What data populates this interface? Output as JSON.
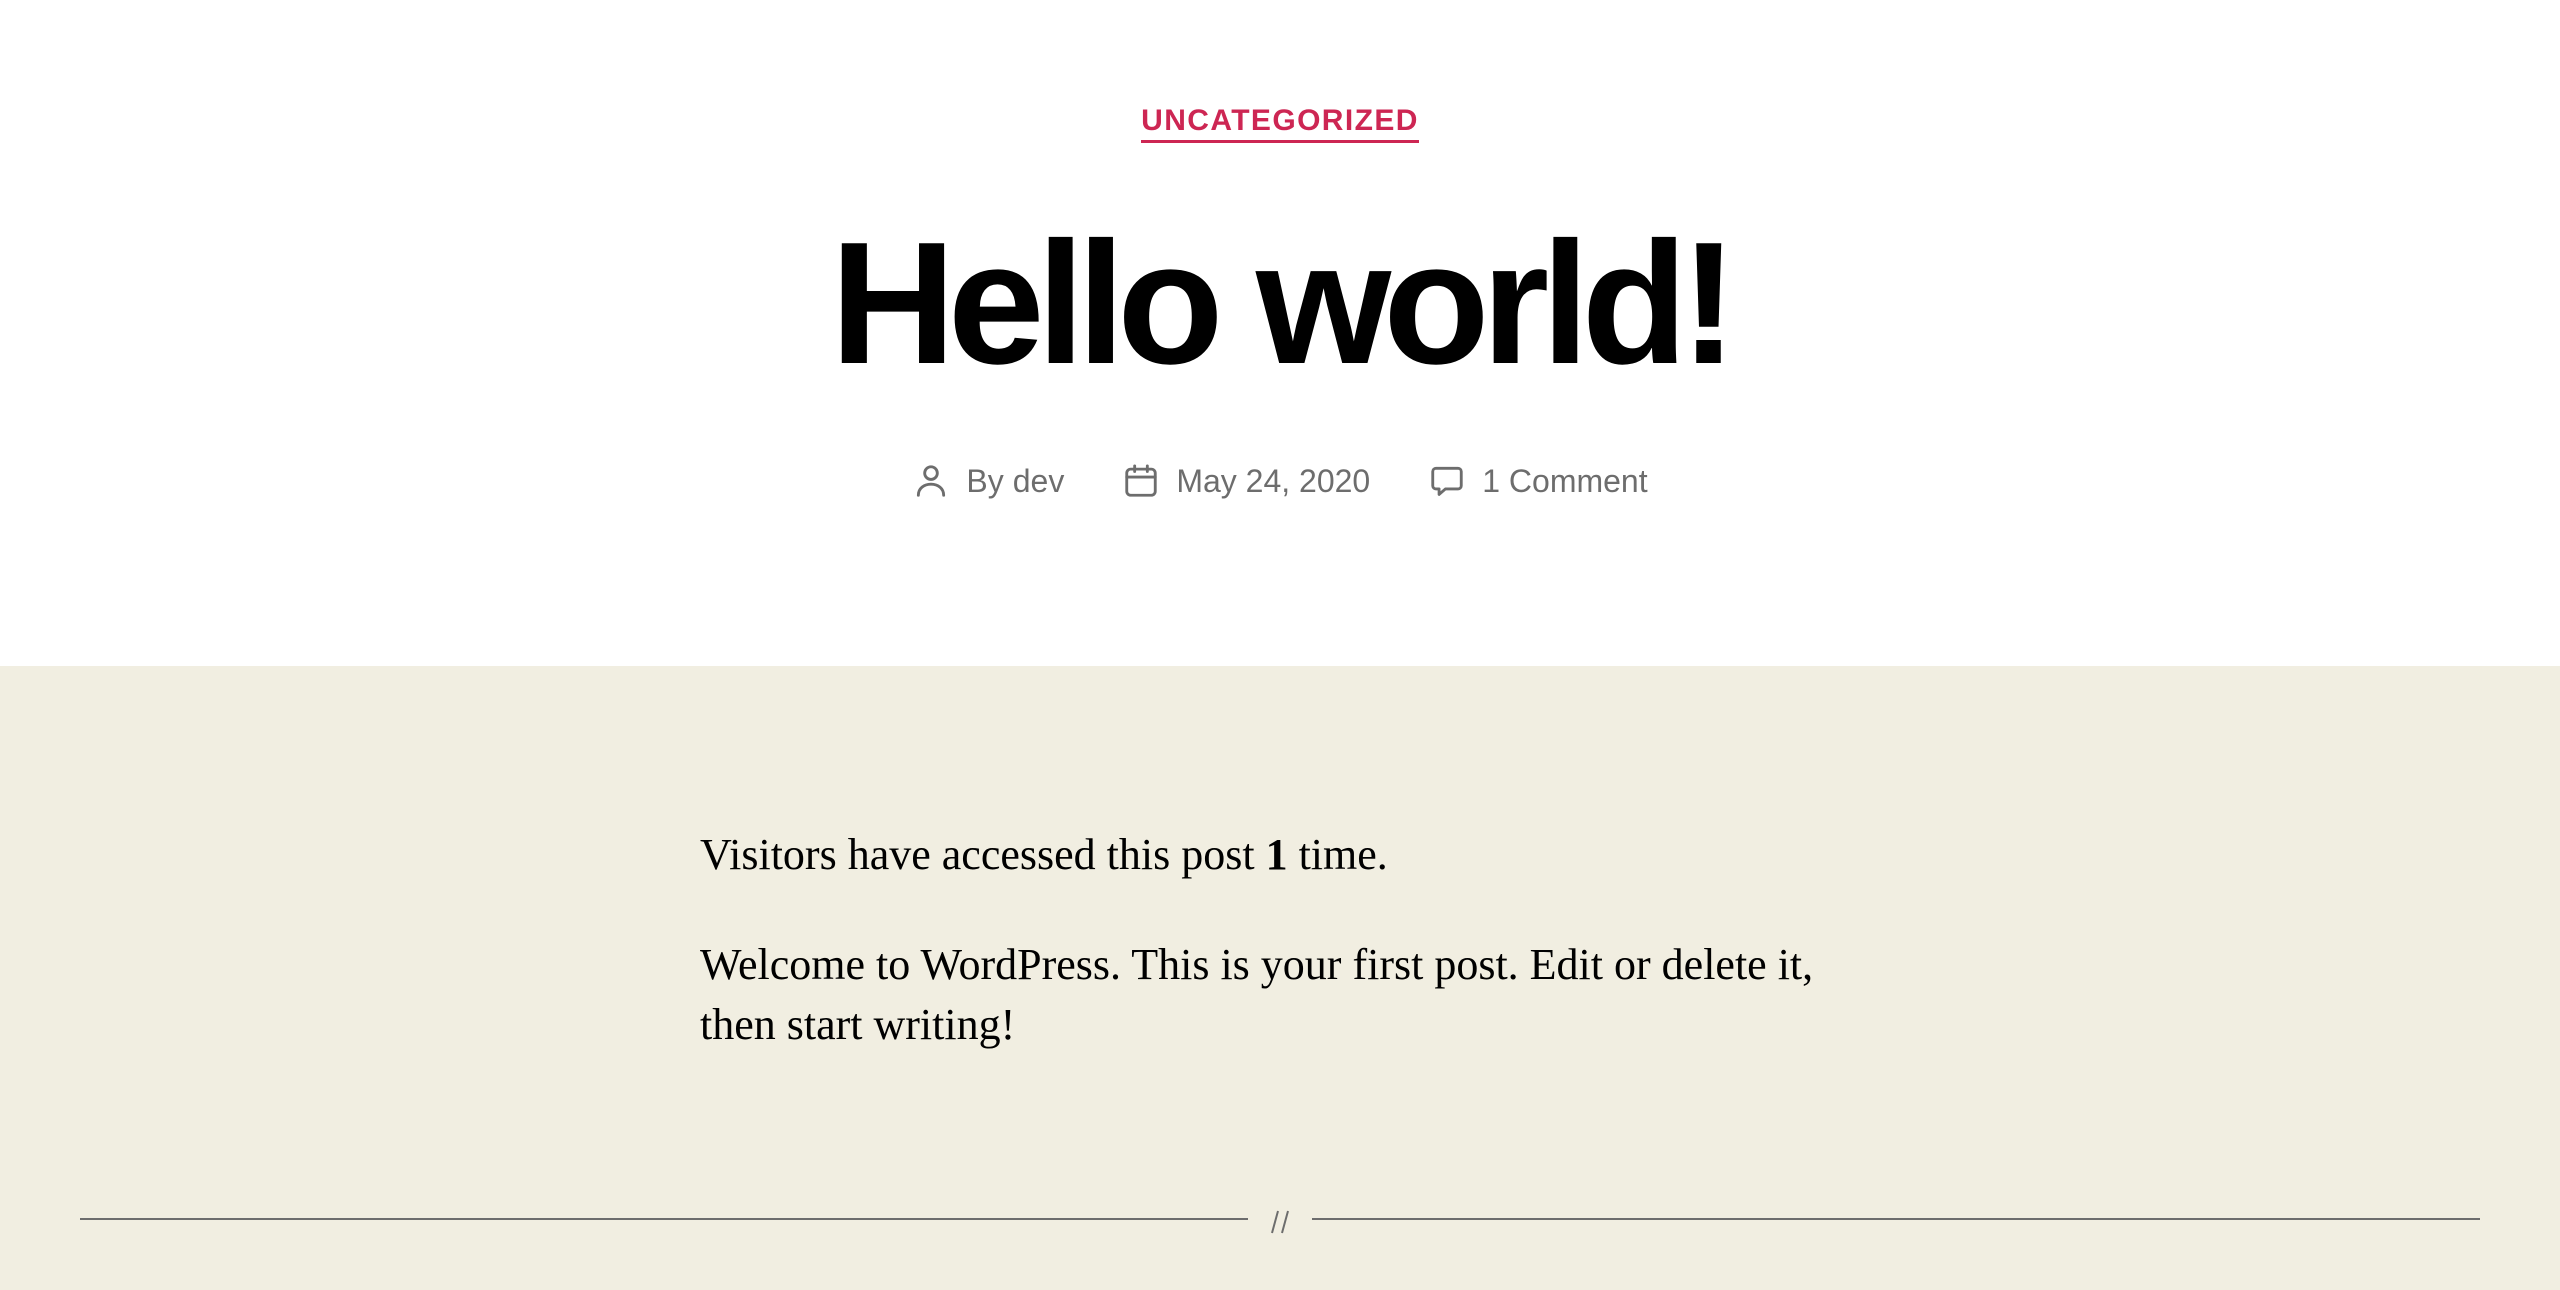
{
  "post": {
    "category": "UNCATEGORIZED",
    "title": "Hello world!",
    "meta": {
      "author_prefix": "By",
      "author": "dev",
      "date": "May 24, 2020",
      "comments": "1 Comment"
    },
    "content": {
      "visitor_text_before": "Visitors have accessed this post",
      "visitor_count": "1",
      "visitor_text_after": "time.",
      "paragraph": "Welcome to WordPress. This is your first post. Edit or delete it, then start writing!"
    }
  },
  "icons": {
    "author": "user-icon",
    "date": "calendar-icon",
    "comments": "speech-bubble-icon",
    "separator": "double-slash-separator"
  },
  "colors": {
    "accent": "#cd2653",
    "meta_text": "#6d6d6d",
    "body_background": "#f1eee1",
    "header_background": "#ffffff",
    "title_text": "#000000"
  }
}
